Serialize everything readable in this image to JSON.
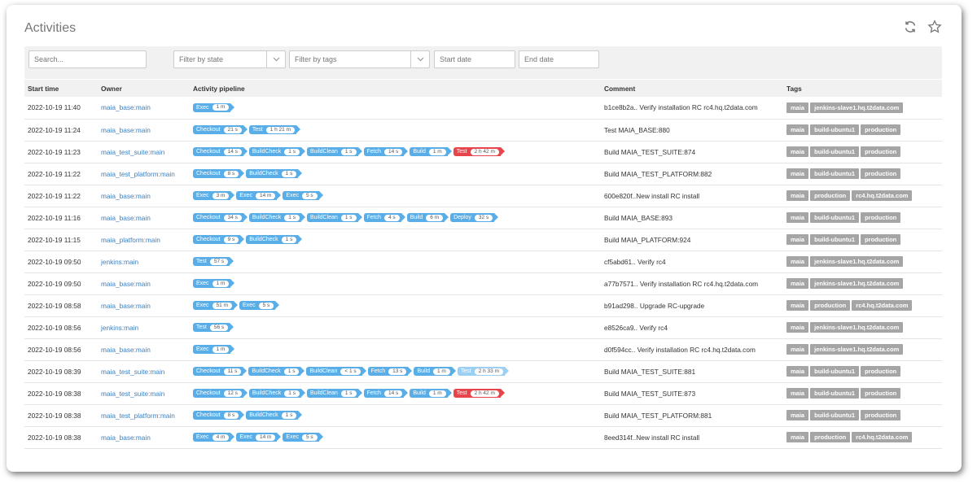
{
  "title": "Activities",
  "icons": {
    "refresh": "refresh-icon",
    "favorite": "star-icon"
  },
  "filters": {
    "search_placeholder": "Search...",
    "state_placeholder": "Filter by state",
    "tags_placeholder": "Filter by tags",
    "start_date_placeholder": "Start date",
    "end_date_placeholder": "End date"
  },
  "columns": {
    "start_time": "Start time",
    "owner": "Owner",
    "pipeline": "Activity pipeline",
    "comment": "Comment",
    "tags": "Tags"
  },
  "colors": {
    "stage": "#5aaee8",
    "failed": "#e8444b",
    "tag": "#a5a5a5",
    "link": "#3f7fbf"
  },
  "rows": [
    {
      "start_time": "2022-10-19 11:40",
      "owner": "maia_base:main",
      "stages": [
        {
          "name": "Exec",
          "duration": "1 m"
        }
      ],
      "comment": "b1ce8b2a.. Verify installation RC rc4.hq.t2data.com",
      "tags": [
        "maia",
        "jenkins-slave1.hq.t2data.com"
      ]
    },
    {
      "start_time": "2022-10-19 11:24",
      "owner": "maia_base:main",
      "stages": [
        {
          "name": "Checkout",
          "duration": "21 s"
        },
        {
          "name": "Test",
          "duration": "1 h 21 m"
        }
      ],
      "comment": "Test MAIA_BASE:880",
      "tags": [
        "maia",
        "build-ubuntu1",
        "production"
      ]
    },
    {
      "start_time": "2022-10-19 11:23",
      "owner": "maia_test_suite:main",
      "stages": [
        {
          "name": "Checkout",
          "duration": "14 s"
        },
        {
          "name": "BuildCheck",
          "duration": "1 s"
        },
        {
          "name": "BuildClean",
          "duration": "1 s"
        },
        {
          "name": "Fetch",
          "duration": "14 s"
        },
        {
          "name": "Build",
          "duration": "1 m"
        },
        {
          "name": "Test",
          "duration": "2 h 42 m",
          "status": "failed"
        }
      ],
      "comment": "Build MAIA_TEST_SUITE:874",
      "tags": [
        "maia",
        "build-ubuntu1",
        "production"
      ]
    },
    {
      "start_time": "2022-10-19 11:22",
      "owner": "maia_test_platform:main",
      "stages": [
        {
          "name": "Checkout",
          "duration": "8 s"
        },
        {
          "name": "BuildCheck",
          "duration": "1 s"
        }
      ],
      "comment": "Build MAIA_TEST_PLATFORM:882",
      "tags": [
        "maia",
        "build-ubuntu1",
        "production"
      ]
    },
    {
      "start_time": "2022-10-19 11:22",
      "owner": "maia_base:main",
      "stages": [
        {
          "name": "Exec",
          "duration": "3 m"
        },
        {
          "name": "Exec",
          "duration": "14 m"
        },
        {
          "name": "Exec",
          "duration": "5 s"
        }
      ],
      "comment": "600e820f..New install RC install",
      "tags": [
        "maia",
        "production",
        "rc4.hq.t2data.com"
      ]
    },
    {
      "start_time": "2022-10-19 11:16",
      "owner": "maia_base:main",
      "stages": [
        {
          "name": "Checkout",
          "duration": "34 s"
        },
        {
          "name": "BuildCheck",
          "duration": "1 s"
        },
        {
          "name": "BuildClean",
          "duration": "1 s"
        },
        {
          "name": "Fetch",
          "duration": "4 s"
        },
        {
          "name": "Build",
          "duration": "6 m"
        },
        {
          "name": "Deploy",
          "duration": "32 s"
        }
      ],
      "comment": "Build MAIA_BASE:893",
      "tags": [
        "maia",
        "build-ubuntu1",
        "production"
      ]
    },
    {
      "start_time": "2022-10-19 11:15",
      "owner": "maia_platform:main",
      "stages": [
        {
          "name": "Checkout",
          "duration": "9 s"
        },
        {
          "name": "BuildCheck",
          "duration": "1 s"
        }
      ],
      "comment": "Build MAIA_PLATFORM:924",
      "tags": [
        "maia",
        "build-ubuntu1",
        "production"
      ]
    },
    {
      "start_time": "2022-10-19 09:50",
      "owner": "jenkins:main",
      "stages": [
        {
          "name": "Test",
          "duration": "57 s"
        }
      ],
      "comment": "cf5abd61.. Verify rc4",
      "tags": [
        "maia",
        "jenkins-slave1.hq.t2data.com"
      ]
    },
    {
      "start_time": "2022-10-19 09:50",
      "owner": "maia_base:main",
      "stages": [
        {
          "name": "Exec",
          "duration": "1 m"
        }
      ],
      "comment": "a77b7571.. Verify installation RC rc4.hq.t2data.com",
      "tags": [
        "maia",
        "jenkins-slave1.hq.t2data.com"
      ]
    },
    {
      "start_time": "2022-10-19 08:58",
      "owner": "maia_base:main",
      "stages": [
        {
          "name": "Exec",
          "duration": "51 m"
        },
        {
          "name": "Exec",
          "duration": "5 s"
        }
      ],
      "comment": "b91ad298.. Upgrade RC-upgrade",
      "tags": [
        "maia",
        "production",
        "rc4.hq.t2data.com"
      ]
    },
    {
      "start_time": "2022-10-19 08:56",
      "owner": "jenkins:main",
      "stages": [
        {
          "name": "Test",
          "duration": "56 s"
        }
      ],
      "comment": "e8526ca9.. Verify rc4",
      "tags": [
        "maia",
        "jenkins-slave1.hq.t2data.com"
      ]
    },
    {
      "start_time": "2022-10-19 08:56",
      "owner": "maia_base:main",
      "stages": [
        {
          "name": "Exec",
          "duration": "1 m"
        }
      ],
      "comment": "d0f594cc.. Verify installation RC rc4.hq.t2data.com",
      "tags": [
        "maia",
        "jenkins-slave1.hq.t2data.com"
      ]
    },
    {
      "start_time": "2022-10-19 08:39",
      "owner": "maia_test_suite:main",
      "stages": [
        {
          "name": "Checkout",
          "duration": "11 s"
        },
        {
          "name": "BuildCheck",
          "duration": "1 s"
        },
        {
          "name": "BuildClean",
          "duration": "< 1 s"
        },
        {
          "name": "Fetch",
          "duration": "13 s"
        },
        {
          "name": "Build",
          "duration": "1 m"
        },
        {
          "name": "Test",
          "duration": "2 h 33 m",
          "status": "running"
        }
      ],
      "comment": "Build MAIA_TEST_SUITE:881",
      "tags": [
        "maia",
        "build-ubuntu1",
        "production"
      ]
    },
    {
      "start_time": "2022-10-19 08:38",
      "owner": "maia_test_suite:main",
      "stages": [
        {
          "name": "Checkout",
          "duration": "12 s"
        },
        {
          "name": "BuildCheck",
          "duration": "1 s"
        },
        {
          "name": "BuildClean",
          "duration": "1 s"
        },
        {
          "name": "Fetch",
          "duration": "14 s"
        },
        {
          "name": "Build",
          "duration": "1 m"
        },
        {
          "name": "Test",
          "duration": "2 h 42 m",
          "status": "failed"
        }
      ],
      "comment": "Build MAIA_TEST_SUITE:873",
      "tags": [
        "maia",
        "build-ubuntu1",
        "production"
      ]
    },
    {
      "start_time": "2022-10-19 08:38",
      "owner": "maia_test_platform:main",
      "stages": [
        {
          "name": "Checkout",
          "duration": "8 s"
        },
        {
          "name": "BuildCheck",
          "duration": "1 s"
        }
      ],
      "comment": "Build MAIA_TEST_PLATFORM:881",
      "tags": [
        "maia",
        "build-ubuntu1",
        "production"
      ]
    },
    {
      "start_time": "2022-10-19 08:38",
      "owner": "maia_base:main",
      "stages": [
        {
          "name": "Exec",
          "duration": "4 m"
        },
        {
          "name": "Exec",
          "duration": "14 m"
        },
        {
          "name": "Exec",
          "duration": "5 s"
        }
      ],
      "comment": "8eed314f..New install RC install",
      "tags": [
        "maia",
        "production",
        "rc4.hq.t2data.com"
      ]
    }
  ]
}
